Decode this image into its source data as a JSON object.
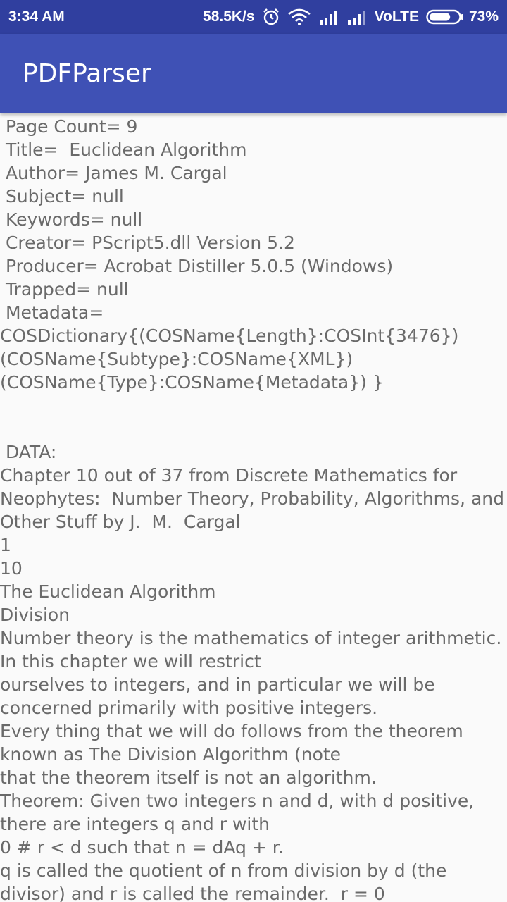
{
  "status_bar": {
    "time": "3:34 AM",
    "net_speed": "58.5K/s",
    "volte": "VoLTE",
    "battery": "73%",
    "battery_level": 0.73,
    "icons": [
      "alarm-icon",
      "wifi-icon",
      "signal-icon",
      "signal-icon",
      "battery-icon"
    ]
  },
  "app_bar": {
    "title": "PDFParser"
  },
  "content": {
    "metadata_lines": [
      " Page Count= 9",
      " Title=  Euclidean Algorithm",
      " Author= James M. Cargal",
      " Subject= null",
      " Keywords= null",
      " Creator= PScript5.dll Version 5.2",
      " Producer= Acrobat Distiller 5.0.5 (Windows)",
      " Trapped= null",
      " Metadata=",
      "COSDictionary{(COSName{Length}:COSInt{3476})",
      "(COSName{Subtype}:COSName{XML})",
      "(COSName{Type}:COSName{Metadata}) }",
      "",
      "",
      " DATA:"
    ],
    "data_lines": [
      "Chapter 10 out of 37 from Discrete Mathematics for",
      "Neophytes:  Number Theory, Probability, Algorithms, and",
      "Other Stuff by J.  M.  Cargal",
      "1",
      "10",
      "The Euclidean Algorithm",
      "Division",
      "Number theory is the mathematics of integer arithmetic.",
      "In this chapter we will restrict",
      "ourselves to integers, and in particular we will be",
      "concerned primarily with positive integers.",
      "Every thing that we will do follows from the theorem",
      "known as The Division Algorithm (note",
      "that the theorem itself is not an algorithm.",
      "Theorem: Given two integers n and d, with d positive,",
      "there are integers q and r with",
      "0 # r < d such that n = dAq + r.",
      "q is called the quotient of n from division by d (the",
      "divisor) and r is called the remainder.  r = 0"
    ]
  }
}
